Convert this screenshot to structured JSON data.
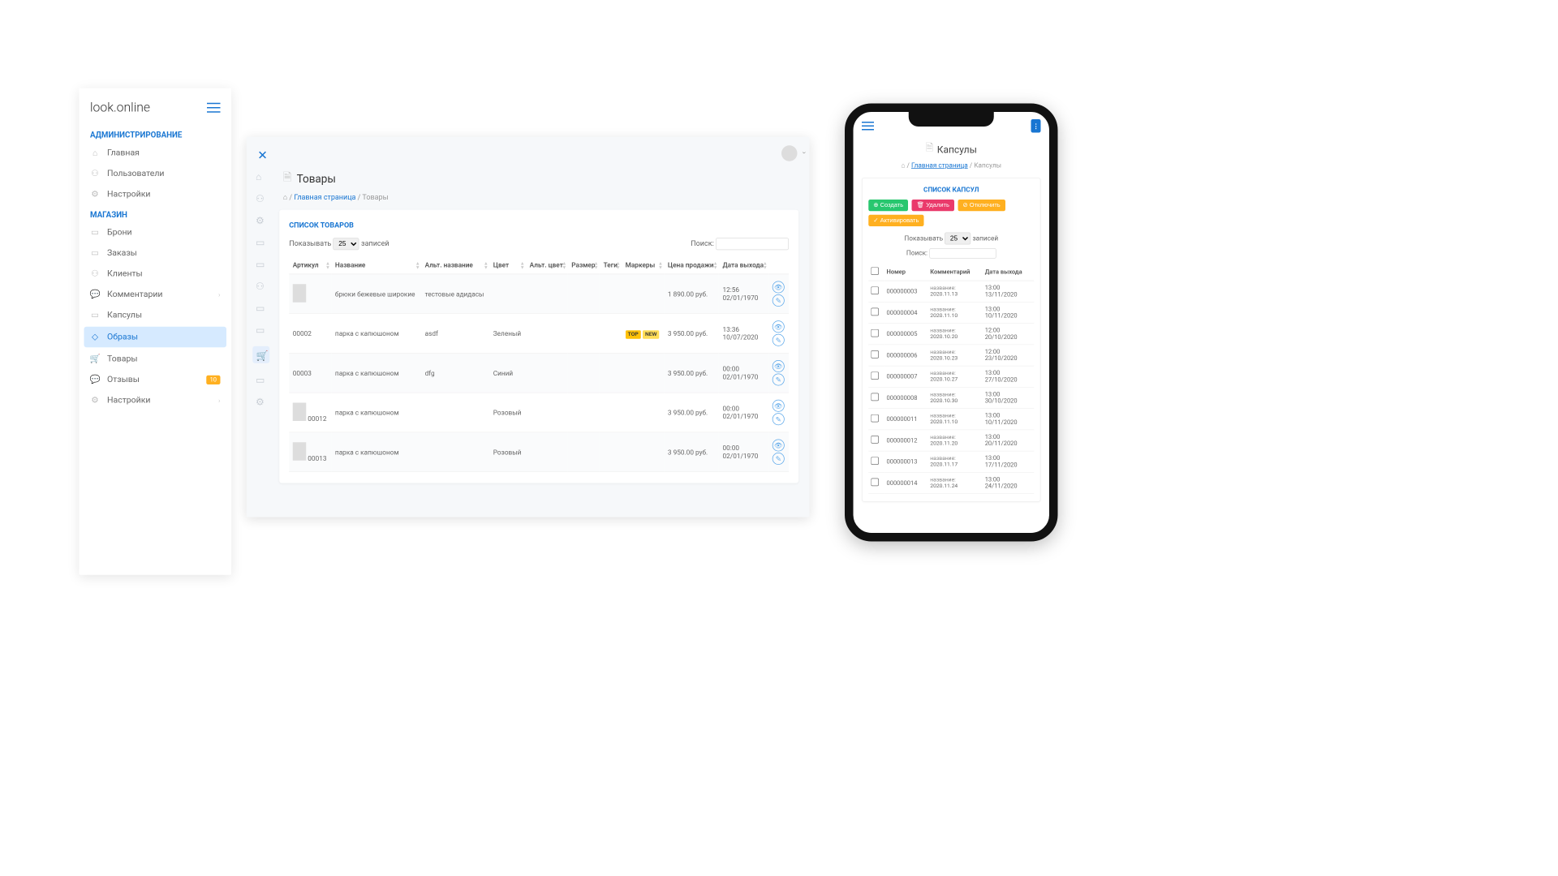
{
  "sidebar": {
    "brand": "look.online",
    "section_admin": "АДМИНИСТРИРОВАНИЕ",
    "section_shop": "МАГАЗИН",
    "items_admin": [
      {
        "label": "Главная",
        "icon": "home"
      },
      {
        "label": "Пользователи",
        "icon": "users"
      },
      {
        "label": "Настройки",
        "icon": "gear"
      }
    ],
    "items_shop": [
      {
        "label": "Брони",
        "icon": "book"
      },
      {
        "label": "Заказы",
        "icon": "doc"
      },
      {
        "label": "Клиенты",
        "icon": "users"
      },
      {
        "label": "Комментарии",
        "icon": "chat",
        "chevron": true
      },
      {
        "label": "Капсулы",
        "icon": "box"
      },
      {
        "label": "Образы",
        "icon": "diamond",
        "active": true
      },
      {
        "label": "Товары",
        "icon": "cart"
      },
      {
        "label": "Отзывы",
        "icon": "chat",
        "badge": "10"
      },
      {
        "label": "Настройки",
        "icon": "gear",
        "chevron": true
      }
    ]
  },
  "desktop": {
    "title": "Товары",
    "card_title": "СПИСОК ТОВАРОВ",
    "breadcrumb_home": "Главная страница",
    "breadcrumb_current": "Товары",
    "show_label_pre": "Показывать",
    "show_label_post": "записей",
    "show_value": "25",
    "search_label": "Поиск:",
    "columns": [
      "Артикул",
      "Название",
      "Альт. название",
      "Цвет",
      "Альт. цвет",
      "Размер",
      "Теги",
      "Маркеры",
      "Цена продажи",
      "Дата выхода",
      ""
    ],
    "rows": [
      {
        "art": "",
        "thumb": true,
        "name": "брюки бежевые широкие",
        "alt": "тестовые адидасы",
        "color": "",
        "altcolor": "",
        "size": "",
        "tags": "",
        "markers": [],
        "price": "1 890.00 руб.",
        "date_t": "12:56",
        "date_d": "02/01/1970"
      },
      {
        "art": "00002",
        "thumb": false,
        "name": "парка с капюшоном",
        "alt": "asdf",
        "color": "Зеленый",
        "altcolor": "",
        "size": "",
        "tags": "",
        "markers": [
          "TOP",
          "NEW"
        ],
        "price": "3 950.00 руб.",
        "date_t": "13:36",
        "date_d": "10/07/2020"
      },
      {
        "art": "00003",
        "thumb": false,
        "name": "парка с капюшоном",
        "alt": "dfg",
        "color": "Синий",
        "altcolor": "",
        "size": "",
        "tags": "",
        "markers": [],
        "price": "3 950.00 руб.",
        "date_t": "00:00",
        "date_d": "02/01/1970"
      },
      {
        "art": "00012",
        "thumb": true,
        "name": "парка с капюшоном",
        "alt": "",
        "color": "Розовый",
        "altcolor": "",
        "size": "",
        "tags": "",
        "markers": [],
        "price": "3 950.00 руб.",
        "date_t": "00:00",
        "date_d": "02/01/1970"
      },
      {
        "art": "00013",
        "thumb": true,
        "name": "парка с капюшоном",
        "alt": "",
        "color": "Розовый",
        "altcolor": "",
        "size": "",
        "tags": "",
        "markers": [],
        "price": "3 950.00 руб.",
        "date_t": "00:00",
        "date_d": "02/01/1970"
      }
    ]
  },
  "mobile": {
    "title": "Капсулы",
    "crumb_home": "Главная страница",
    "crumb_current": "Капсулы",
    "card_title": "СПИСОК КАПСУЛ",
    "btn_create": "Создать",
    "btn_delete": "Удалить",
    "btn_disable": "Отключить",
    "btn_activate": "Активировать",
    "show_pre": "Показывать",
    "show_post": "записей",
    "show_value": "25",
    "search_label": "Поиск:",
    "col_number": "Номер",
    "col_comment": "Комментарий",
    "col_date": "Дата выхода",
    "comment_label": "название:",
    "rows": [
      {
        "num": "000000003",
        "comment": "2020.11.13",
        "date_t": "13:00",
        "date_d": "13/11/2020"
      },
      {
        "num": "000000004",
        "comment": "2020.11.10",
        "date_t": "13:00",
        "date_d": "10/11/2020"
      },
      {
        "num": "000000005",
        "comment": "2020.10.20",
        "date_t": "12:00",
        "date_d": "20/10/2020"
      },
      {
        "num": "000000006",
        "comment": "2020.10.23",
        "date_t": "12:00",
        "date_d": "23/10/2020"
      },
      {
        "num": "000000007",
        "comment": "2020.10.27",
        "date_t": "13:00",
        "date_d": "27/10/2020"
      },
      {
        "num": "000000008",
        "comment": "2020.10.30",
        "date_t": "13:00",
        "date_d": "30/10/2020"
      },
      {
        "num": "000000011",
        "comment": "2020.11.10",
        "date_t": "13:00",
        "date_d": "10/11/2020"
      },
      {
        "num": "000000012",
        "comment": "2020.11.20",
        "date_t": "13:00",
        "date_d": "20/11/2020"
      },
      {
        "num": "000000013",
        "comment": "2020.11.17",
        "date_t": "13:00",
        "date_d": "17/11/2020"
      },
      {
        "num": "000000014",
        "comment": "2020.11.24",
        "date_t": "13:00",
        "date_d": "24/11/2020"
      }
    ]
  }
}
